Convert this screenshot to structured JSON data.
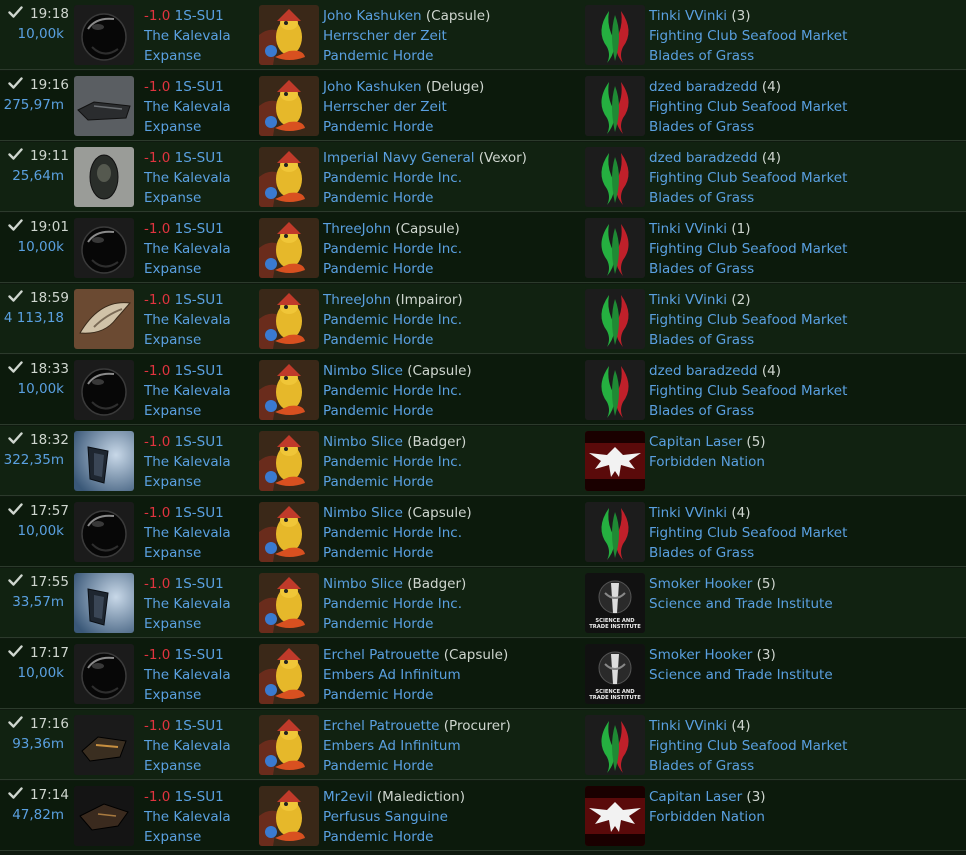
{
  "rows": [
    {
      "time": "19:18",
      "value": "10,00k",
      "sec": "-1.0",
      "system": "1S-SU1",
      "region": "The Kalevala",
      "constellation": "Expanse",
      "ship_icon": "capsule-icon",
      "victim": {
        "name": "Joho Kashuken",
        "ship": "(Capsule)",
        "corp": "Herrscher der Zeit",
        "alliance": "Pandemic Horde"
      },
      "attacker": {
        "name": "Tinki VVinki",
        "count": "(3)",
        "corp": "Fighting Club Seafood Market",
        "alliance": "Blades of Grass",
        "logo": "blades-of-grass-logo"
      }
    },
    {
      "time": "19:16",
      "value": "275,97m",
      "sec": "-1.0",
      "system": "1S-SU1",
      "region": "The Kalevala",
      "constellation": "Expanse",
      "ship_icon": "deluge-icon",
      "victim": {
        "name": "Joho Kashuken",
        "ship": "(Deluge)",
        "corp": "Herrscher der Zeit",
        "alliance": "Pandemic Horde"
      },
      "attacker": {
        "name": "dzed baradzedd",
        "count": "(4)",
        "corp": "Fighting Club Seafood Market",
        "alliance": "Blades of Grass",
        "logo": "blades-of-grass-logo"
      }
    },
    {
      "time": "19:11",
      "value": "25,64m",
      "sec": "-1.0",
      "system": "1S-SU1",
      "region": "The Kalevala",
      "constellation": "Expanse",
      "ship_icon": "vexor-icon",
      "victim": {
        "name": "Imperial Navy General",
        "ship": "(Vexor)",
        "corp": "Pandemic Horde Inc.",
        "alliance": "Pandemic Horde"
      },
      "attacker": {
        "name": "dzed baradzedd",
        "count": "(4)",
        "corp": "Fighting Club Seafood Market",
        "alliance": "Blades of Grass",
        "logo": "blades-of-grass-logo"
      }
    },
    {
      "time": "19:01",
      "value": "10,00k",
      "sec": "-1.0",
      "system": "1S-SU1",
      "region": "The Kalevala",
      "constellation": "Expanse",
      "ship_icon": "capsule-icon",
      "victim": {
        "name": "ThreeJohn",
        "ship": "(Capsule)",
        "corp": "Pandemic Horde Inc.",
        "alliance": "Pandemic Horde"
      },
      "attacker": {
        "name": "Tinki VVinki",
        "count": "(1)",
        "corp": "Fighting Club Seafood Market",
        "alliance": "Blades of Grass",
        "logo": "blades-of-grass-logo"
      }
    },
    {
      "time": "18:59",
      "value": "4 113,18",
      "sec": "-1.0",
      "system": "1S-SU1",
      "region": "The Kalevala",
      "constellation": "Expanse",
      "ship_icon": "impairor-icon",
      "victim": {
        "name": "ThreeJohn",
        "ship": "(Impairor)",
        "corp": "Pandemic Horde Inc.",
        "alliance": "Pandemic Horde"
      },
      "attacker": {
        "name": "Tinki VVinki",
        "count": "(2)",
        "corp": "Fighting Club Seafood Market",
        "alliance": "Blades of Grass",
        "logo": "blades-of-grass-logo"
      }
    },
    {
      "time": "18:33",
      "value": "10,00k",
      "sec": "-1.0",
      "system": "1S-SU1",
      "region": "The Kalevala",
      "constellation": "Expanse",
      "ship_icon": "capsule-icon",
      "victim": {
        "name": "Nimbo Slice",
        "ship": "(Capsule)",
        "corp": "Pandemic Horde Inc.",
        "alliance": "Pandemic Horde"
      },
      "attacker": {
        "name": "dzed baradzedd",
        "count": "(4)",
        "corp": "Fighting Club Seafood Market",
        "alliance": "Blades of Grass",
        "logo": "blades-of-grass-logo"
      }
    },
    {
      "time": "18:32",
      "value": "322,35m",
      "sec": "-1.0",
      "system": "1S-SU1",
      "region": "The Kalevala",
      "constellation": "Expanse",
      "ship_icon": "badger-icon",
      "victim": {
        "name": "Nimbo Slice",
        "ship": "(Badger)",
        "corp": "Pandemic Horde Inc.",
        "alliance": "Pandemic Horde"
      },
      "attacker": {
        "name": "Capitan Laser",
        "count": "(5)",
        "corp": "Forbidden Nation",
        "alliance": "",
        "logo": "forbidden-nation-logo"
      }
    },
    {
      "time": "17:57",
      "value": "10,00k",
      "sec": "-1.0",
      "system": "1S-SU1",
      "region": "The Kalevala",
      "constellation": "Expanse",
      "ship_icon": "capsule-icon",
      "victim": {
        "name": "Nimbo Slice",
        "ship": "(Capsule)",
        "corp": "Pandemic Horde Inc.",
        "alliance": "Pandemic Horde"
      },
      "attacker": {
        "name": "Tinki VVinki",
        "count": "(4)",
        "corp": "Fighting Club Seafood Market",
        "alliance": "Blades of Grass",
        "logo": "blades-of-grass-logo"
      }
    },
    {
      "time": "17:55",
      "value": "33,57m",
      "sec": "-1.0",
      "system": "1S-SU1",
      "region": "The Kalevala",
      "constellation": "Expanse",
      "ship_icon": "badger-icon",
      "victim": {
        "name": "Nimbo Slice",
        "ship": "(Badger)",
        "corp": "Pandemic Horde Inc.",
        "alliance": "Pandemic Horde"
      },
      "attacker": {
        "name": "Smoker Hooker",
        "count": "(5)",
        "corp": "Science and Trade Institute",
        "alliance": "",
        "logo": "science-trade-institute-logo"
      }
    },
    {
      "time": "17:17",
      "value": "10,00k",
      "sec": "-1.0",
      "system": "1S-SU1",
      "region": "The Kalevala",
      "constellation": "Expanse",
      "ship_icon": "capsule-icon",
      "victim": {
        "name": "Erchel Patrouette",
        "ship": "(Capsule)",
        "corp": "Embers Ad Infinitum",
        "alliance": "Pandemic Horde"
      },
      "attacker": {
        "name": "Smoker Hooker",
        "count": "(3)",
        "corp": "Science and Trade Institute",
        "alliance": "",
        "logo": "science-trade-institute-logo"
      }
    },
    {
      "time": "17:16",
      "value": "93,36m",
      "sec": "-1.0",
      "system": "1S-SU1",
      "region": "The Kalevala",
      "constellation": "Expanse",
      "ship_icon": "procurer-icon",
      "victim": {
        "name": "Erchel Patrouette",
        "ship": "(Procurer)",
        "corp": "Embers Ad Infinitum",
        "alliance": "Pandemic Horde"
      },
      "attacker": {
        "name": "Tinki VVinki",
        "count": "(4)",
        "corp": "Fighting Club Seafood Market",
        "alliance": "Blades of Grass",
        "logo": "blades-of-grass-logo"
      }
    },
    {
      "time": "17:14",
      "value": "47,82m",
      "sec": "-1.0",
      "system": "1S-SU1",
      "region": "The Kalevala",
      "constellation": "Expanse",
      "ship_icon": "malediction-icon",
      "victim": {
        "name": "Mr2evil",
        "ship": "(Malediction)",
        "corp": "Perfusus Sanguine",
        "alliance": "Pandemic Horde"
      },
      "attacker": {
        "name": "Capitan Laser",
        "count": "(3)",
        "corp": "Forbidden Nation",
        "alliance": "",
        "logo": "forbidden-nation-logo"
      }
    }
  ],
  "colors": {
    "link": "#5aa0e0",
    "security": "#e0343f",
    "text": "#cfd6cf",
    "row_even": "#112211",
    "row_odd": "#0c1a0c"
  },
  "logo_text": {
    "sti_line1": "SCIENCE AND",
    "sti_line2": "TRADE INSTITUTE"
  }
}
